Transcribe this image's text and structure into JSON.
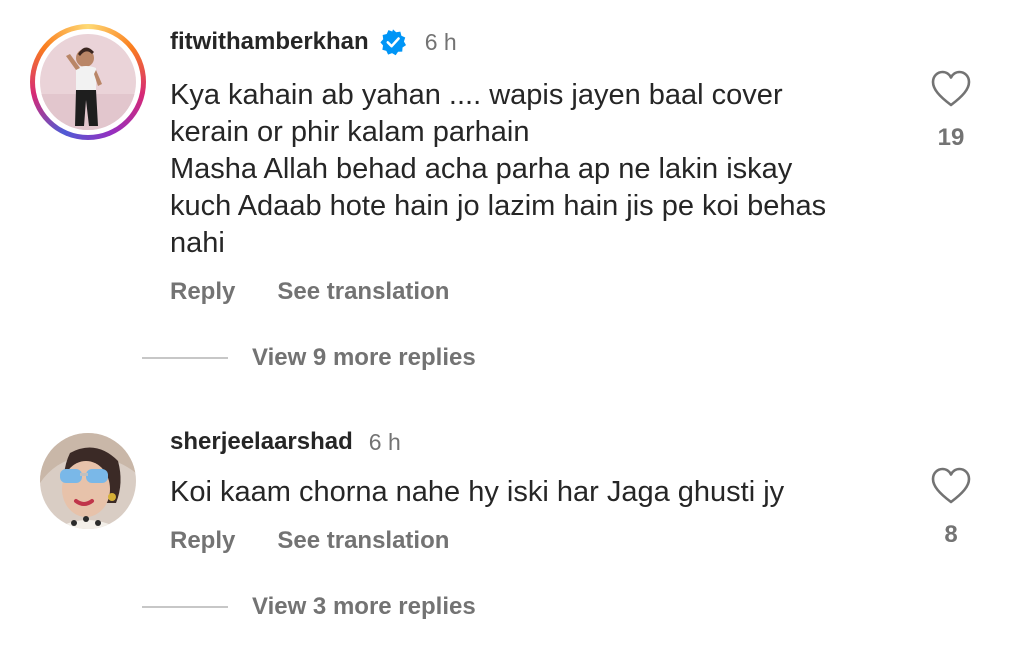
{
  "comments": [
    {
      "username": "fitwithamberkhan",
      "verified": true,
      "time": "6 h",
      "lines": [
        "Kya kahain ab yahan .... wapis jayen baal cover",
        "kerain or phir kalam parhain",
        "Masha Allah behad acha parha ap ne lakin iskay",
        "kuch Adaab hote hain jo lazim hain jis pe koi behas",
        "nahi"
      ],
      "reply_label": "Reply",
      "translate_label": "See translation",
      "likes": "19",
      "view_replies": "View 9 more replies",
      "avatar_icon": "profile-photo-with-story-ring"
    },
    {
      "username": "sherjeelaarshad",
      "verified": false,
      "time": "6 h",
      "lines": [
        "Koi kaam chorna nahe hy iski har Jaga ghusti jy"
      ],
      "reply_label": "Reply",
      "translate_label": "See translation",
      "likes": "8",
      "view_replies": "View 3 more replies",
      "avatar_icon": "profile-photo"
    }
  ],
  "colors": {
    "text_primary": "#262626",
    "text_secondary": "#737373",
    "verified_blue": "#0095f6",
    "divider": "#c7c7c7"
  }
}
